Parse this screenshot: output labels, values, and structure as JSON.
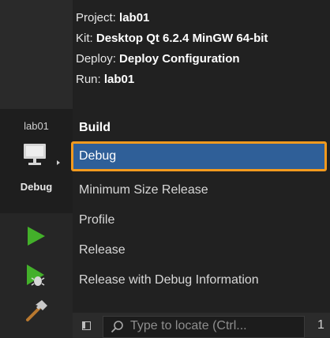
{
  "sidebar": {
    "project_name": "lab01",
    "current_config": "Debug",
    "icons": [
      "monitor-icon",
      "run-icon",
      "debug-run-icon",
      "build-icon"
    ]
  },
  "info": {
    "project_label": "Project:",
    "project_value": "lab01",
    "kit_label": "Kit:",
    "kit_value": "Desktop Qt 6.2.4 MinGW 64-bit",
    "deploy_label": "Deploy:",
    "deploy_value": "Deploy Configuration",
    "run_label": "Run:",
    "run_value": "lab01"
  },
  "build_list": {
    "header": "Build",
    "items": [
      {
        "label": "Debug",
        "selected": true
      },
      {
        "label": "Minimum Size Release",
        "selected": false
      },
      {
        "label": "Profile",
        "selected": false
      },
      {
        "label": "Release",
        "selected": false
      },
      {
        "label": "Release with Debug Information",
        "selected": false
      }
    ]
  },
  "locator": {
    "placeholder": "Type to locate (Ctrl...",
    "trailing": "1"
  },
  "colors": {
    "selection": "#2f5f98",
    "highlight_border": "#f39a1e",
    "run_green": "#43b02a"
  }
}
